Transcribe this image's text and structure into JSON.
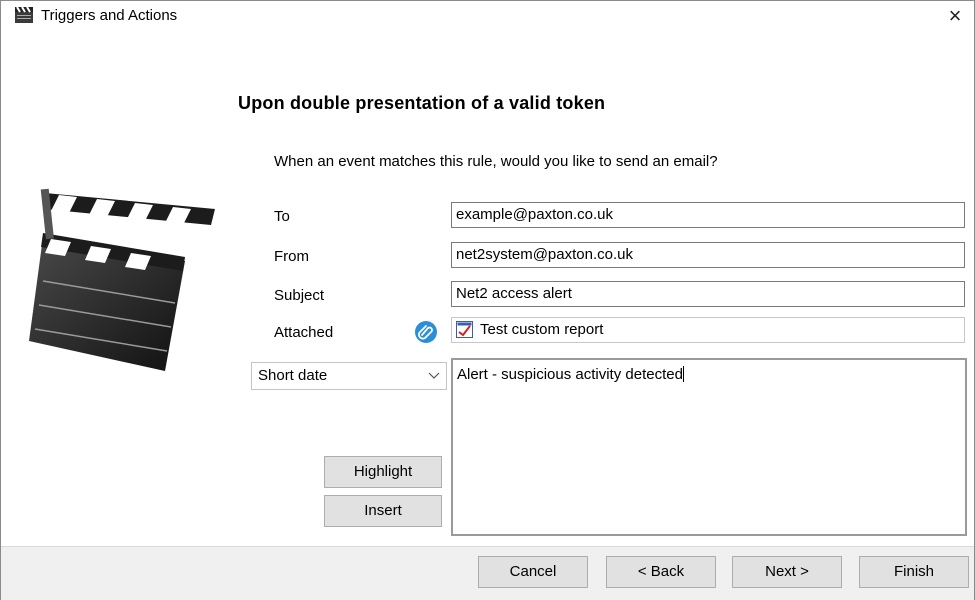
{
  "window": {
    "title": "Triggers and Actions",
    "close_label": "×"
  },
  "heading": "Upon double presentation of a valid token",
  "question": "When an event matches this rule, would you like to send an email?",
  "fields": {
    "to": {
      "label": "To",
      "value": "example@paxton.co.uk"
    },
    "from": {
      "label": "From",
      "value": "net2system@paxton.co.uk"
    },
    "subject": {
      "label": "Subject",
      "value": "Net2 access alert"
    },
    "attached": {
      "label": "Attached",
      "value": "Test custom report"
    }
  },
  "insert_field": {
    "selected": "Short date"
  },
  "message_body": "Alert - suspicious activity detected",
  "side_buttons": {
    "highlight": "Highlight",
    "insert": "Insert"
  },
  "footer_buttons": {
    "cancel": "Cancel",
    "back": "< Back",
    "next": "Next >",
    "finish": "Finish"
  },
  "icons": {
    "title": "clapperboard-icon",
    "close": "close-icon",
    "attach": "paperclip-icon",
    "report": "report-icon",
    "dropdown": "chevron-down-icon",
    "illustration": "clapperboard-icon"
  },
  "colors": {
    "attach_button": "#2b8fd8",
    "footer_background": "#f0f0f0",
    "button_face": "#e1e1e1"
  }
}
